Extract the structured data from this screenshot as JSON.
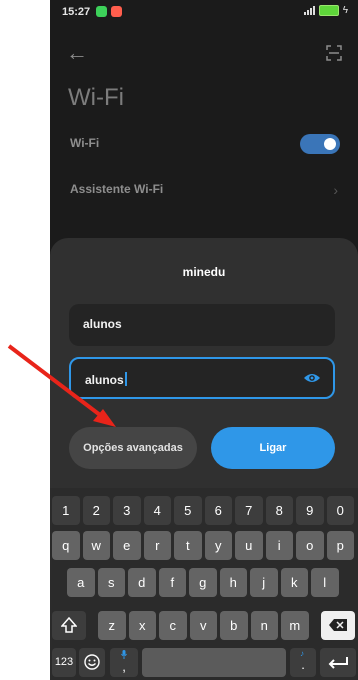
{
  "status": {
    "time": "15:27"
  },
  "header": {
    "title": "Wi-Fi"
  },
  "settings": {
    "wifi_label": "Wi-Fi",
    "wifi_enabled": true,
    "assistant_label": "Assistente Wi-Fi"
  },
  "dialog": {
    "title": "minedu",
    "identity_value": "alunos",
    "password_value": "alunos",
    "advanced_label": "Opções avançadas",
    "connect_label": "Ligar"
  },
  "keyboard": {
    "numbers": [
      "1",
      "2",
      "3",
      "4",
      "5",
      "6",
      "7",
      "8",
      "9",
      "0"
    ],
    "row1": [
      "q",
      "w",
      "e",
      "r",
      "t",
      "y",
      "u",
      "i",
      "o",
      "p"
    ],
    "row2": [
      "a",
      "s",
      "d",
      "f",
      "g",
      "h",
      "j",
      "k",
      "l"
    ],
    "row3": [
      "z",
      "x",
      "c",
      "v",
      "b",
      "n",
      "m"
    ],
    "symbols_label": "123",
    "comma": ",",
    "period": "."
  },
  "colors": {
    "accent": "#2f97e8",
    "arrow": "#e8241a"
  }
}
